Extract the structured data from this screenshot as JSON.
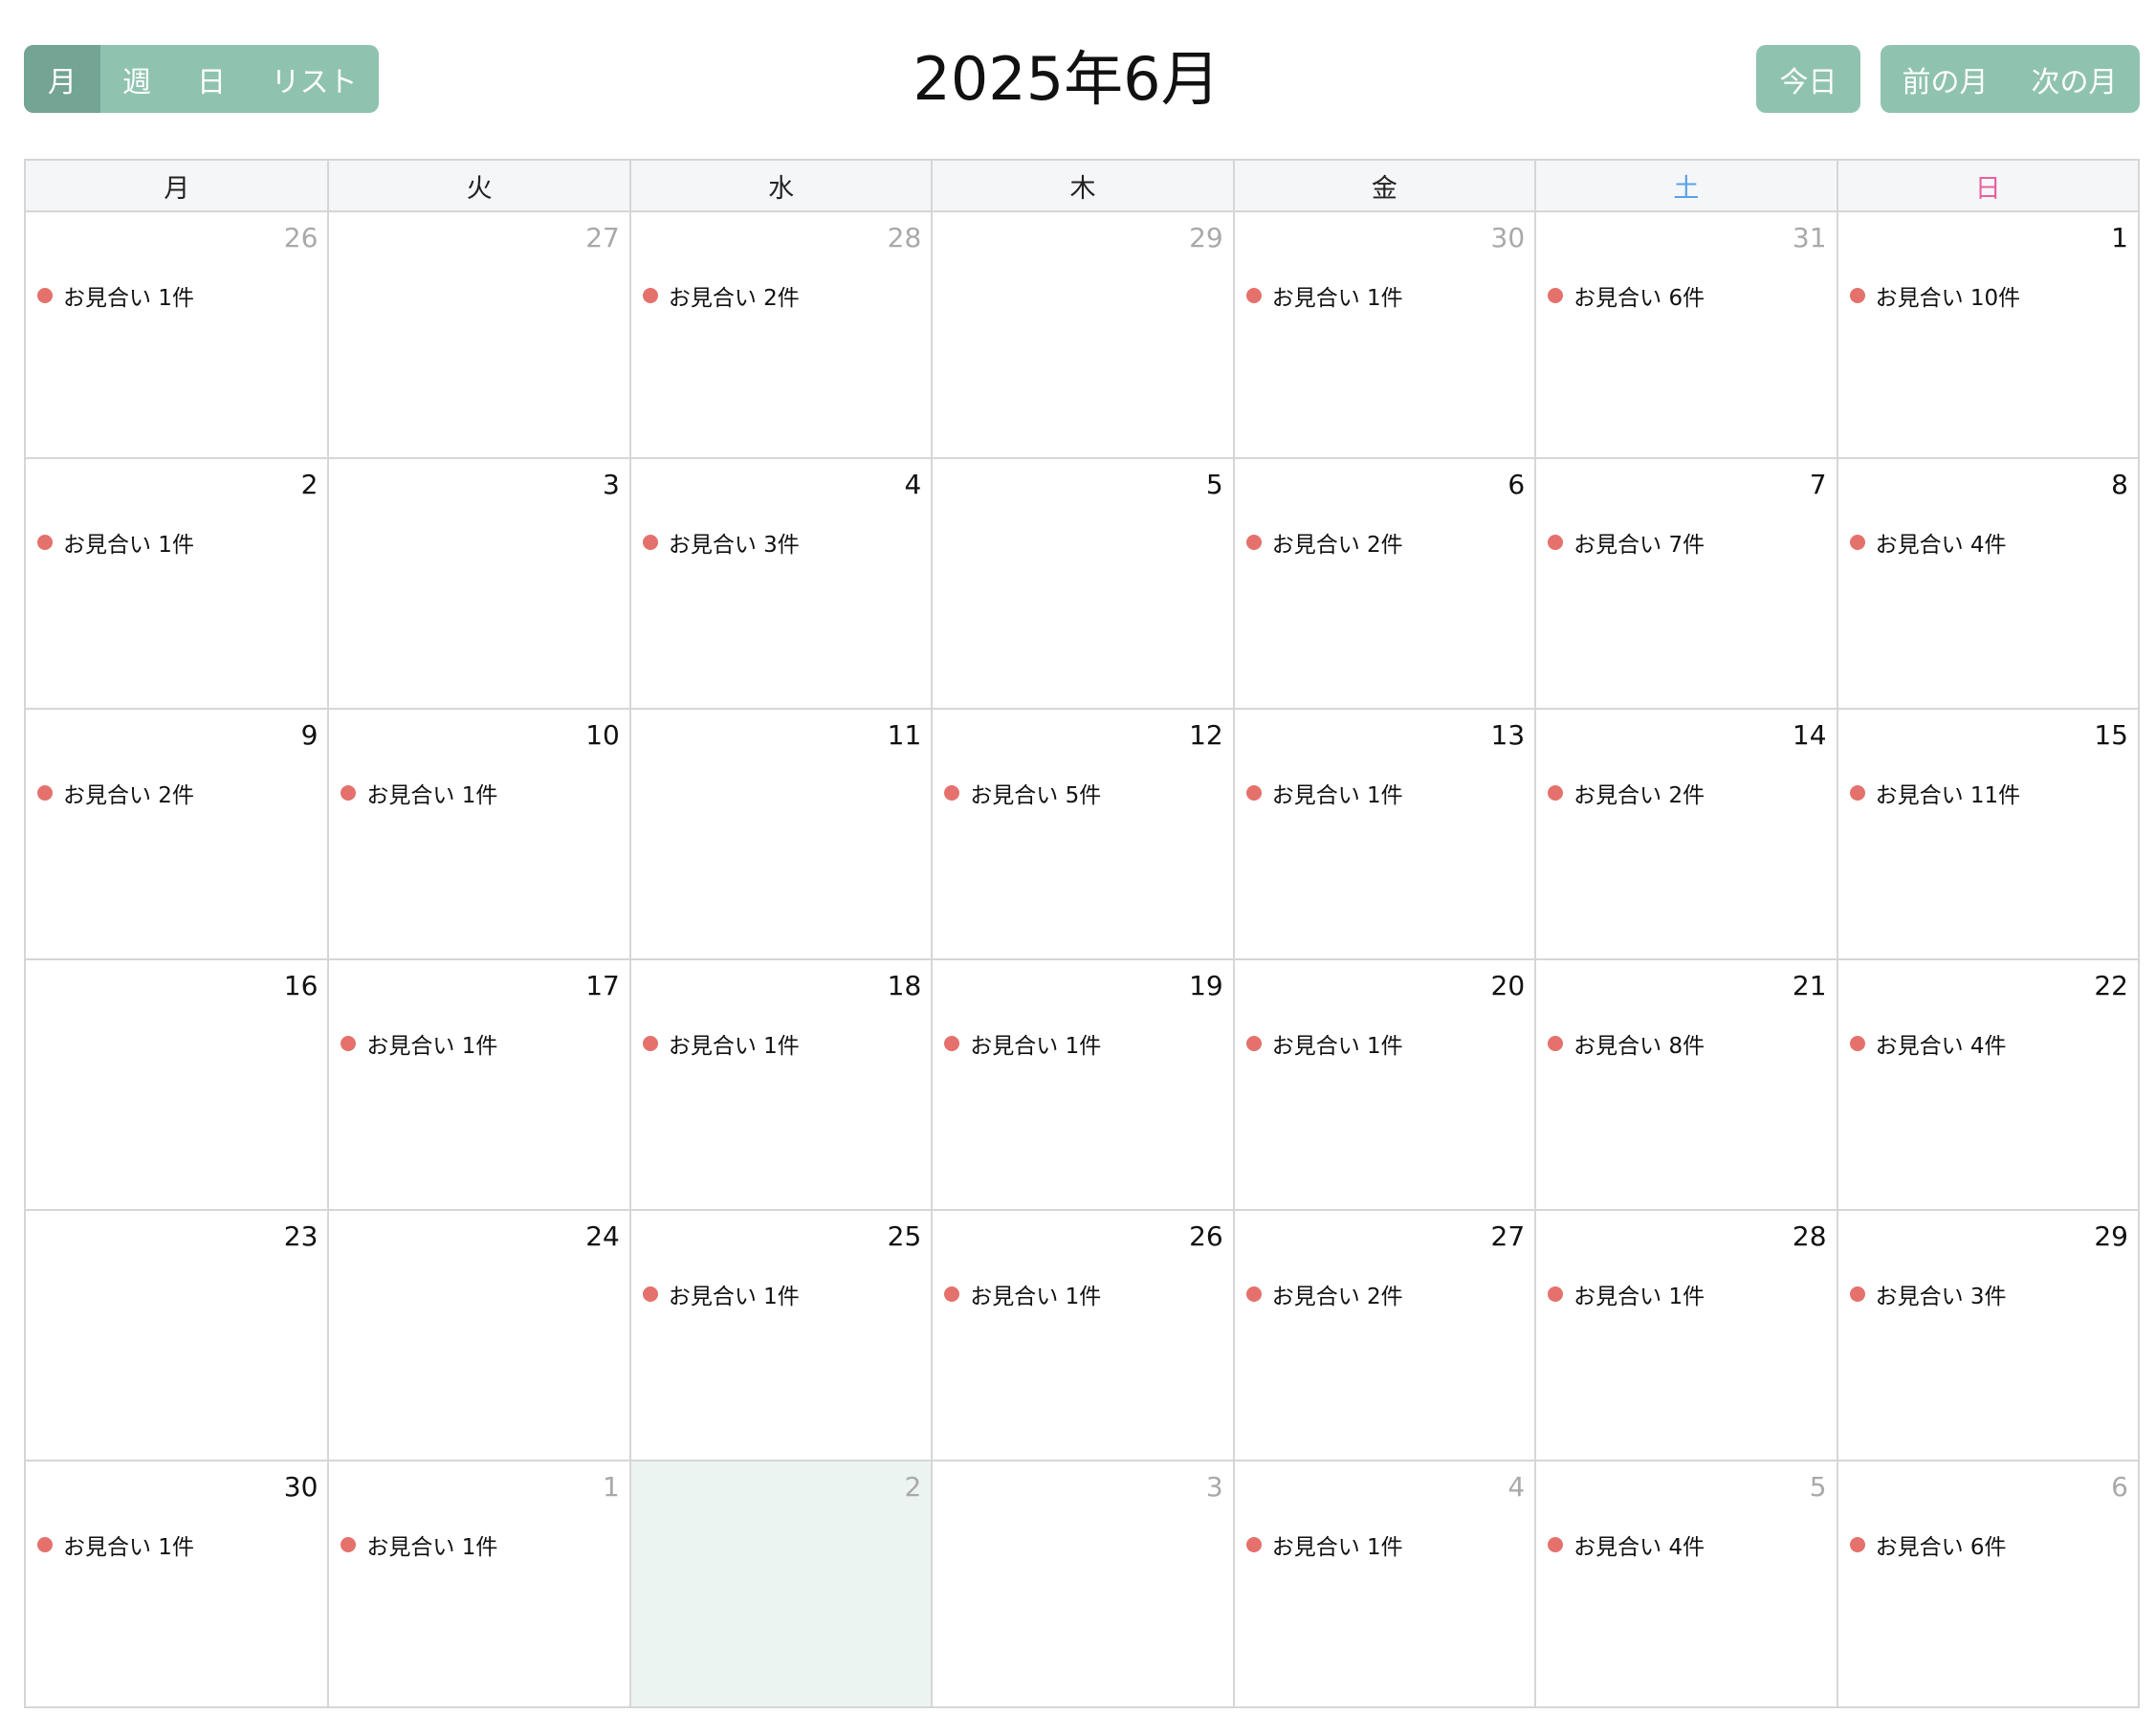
{
  "toolbar": {
    "views": [
      {
        "label": "月",
        "active": true
      },
      {
        "label": "週",
        "active": false
      },
      {
        "label": "日",
        "active": false
      },
      {
        "label": "リスト",
        "active": false
      }
    ],
    "title": "2025年6月",
    "today_label": "今日",
    "prev_label": "前の月",
    "next_label": "次の月"
  },
  "colors": {
    "button_bg": "#8fc3af",
    "button_active_bg": "#74a493",
    "event_dot": "#e5716c",
    "saturday": "#5aa0e8",
    "sunday": "#e8609c",
    "today_bg": "#ebf4f0"
  },
  "weekdays": [
    "月",
    "火",
    "水",
    "木",
    "金",
    "土",
    "日"
  ],
  "weeks": [
    [
      {
        "day": "26",
        "other": true,
        "event": "お見合い 1件"
      },
      {
        "day": "27",
        "other": true,
        "event": ""
      },
      {
        "day": "28",
        "other": true,
        "event": "お見合い 2件"
      },
      {
        "day": "29",
        "other": true,
        "event": ""
      },
      {
        "day": "30",
        "other": true,
        "event": "お見合い 1件"
      },
      {
        "day": "31",
        "other": true,
        "event": "お見合い 6件"
      },
      {
        "day": "1",
        "other": false,
        "event": "お見合い 10件"
      }
    ],
    [
      {
        "day": "2",
        "other": false,
        "event": "お見合い 1件"
      },
      {
        "day": "3",
        "other": false,
        "event": ""
      },
      {
        "day": "4",
        "other": false,
        "event": "お見合い 3件"
      },
      {
        "day": "5",
        "other": false,
        "event": ""
      },
      {
        "day": "6",
        "other": false,
        "event": "お見合い 2件"
      },
      {
        "day": "7",
        "other": false,
        "event": "お見合い 7件"
      },
      {
        "day": "8",
        "other": false,
        "event": "お見合い 4件"
      }
    ],
    [
      {
        "day": "9",
        "other": false,
        "event": "お見合い 2件"
      },
      {
        "day": "10",
        "other": false,
        "event": "お見合い 1件"
      },
      {
        "day": "11",
        "other": false,
        "event": ""
      },
      {
        "day": "12",
        "other": false,
        "event": "お見合い 5件"
      },
      {
        "day": "13",
        "other": false,
        "event": "お見合い 1件"
      },
      {
        "day": "14",
        "other": false,
        "event": "お見合い 2件"
      },
      {
        "day": "15",
        "other": false,
        "event": "お見合い 11件"
      }
    ],
    [
      {
        "day": "16",
        "other": false,
        "event": ""
      },
      {
        "day": "17",
        "other": false,
        "event": "お見合い 1件"
      },
      {
        "day": "18",
        "other": false,
        "event": "お見合い 1件"
      },
      {
        "day": "19",
        "other": false,
        "event": "お見合い 1件"
      },
      {
        "day": "20",
        "other": false,
        "event": "お見合い 1件"
      },
      {
        "day": "21",
        "other": false,
        "event": "お見合い 8件"
      },
      {
        "day": "22",
        "other": false,
        "event": "お見合い 4件"
      }
    ],
    [
      {
        "day": "23",
        "other": false,
        "event": ""
      },
      {
        "day": "24",
        "other": false,
        "event": ""
      },
      {
        "day": "25",
        "other": false,
        "event": "お見合い 1件"
      },
      {
        "day": "26",
        "other": false,
        "event": "お見合い 1件"
      },
      {
        "day": "27",
        "other": false,
        "event": "お見合い 2件"
      },
      {
        "day": "28",
        "other": false,
        "event": "お見合い 1件"
      },
      {
        "day": "29",
        "other": false,
        "event": "お見合い 3件"
      }
    ],
    [
      {
        "day": "30",
        "other": false,
        "event": "お見合い 1件"
      },
      {
        "day": "1",
        "other": true,
        "event": "お見合い 1件"
      },
      {
        "day": "2",
        "other": true,
        "today": true,
        "event": ""
      },
      {
        "day": "3",
        "other": true,
        "event": ""
      },
      {
        "day": "4",
        "other": true,
        "event": "お見合い 1件"
      },
      {
        "day": "5",
        "other": true,
        "event": "お見合い 4件"
      },
      {
        "day": "6",
        "other": true,
        "event": "お見合い 6件"
      }
    ]
  ]
}
